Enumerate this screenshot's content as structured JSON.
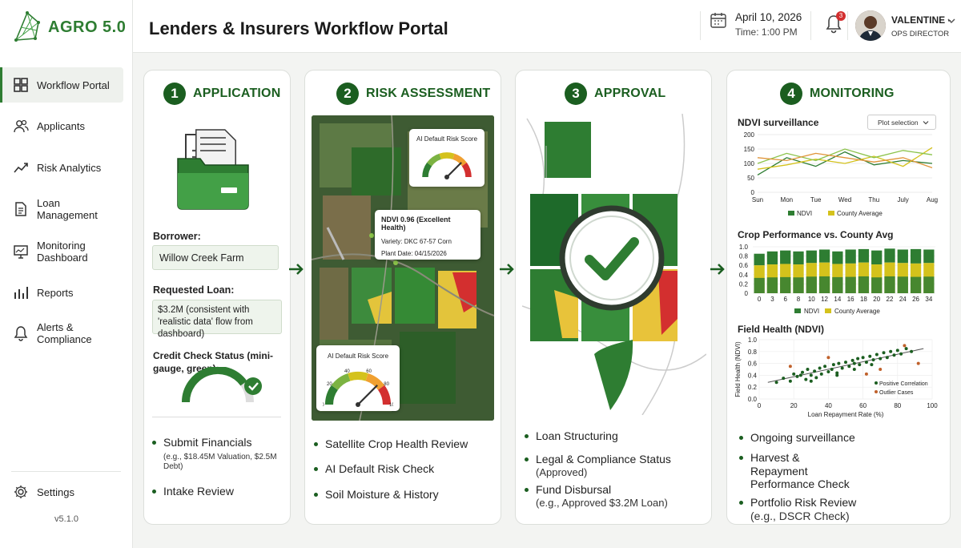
{
  "brand": {
    "name": "AGRO 5.0"
  },
  "header": {
    "title": "Lenders & Insurers Workflow Portal",
    "date": "April 10, 2026",
    "time": "Time: 1:00 PM",
    "notif_count": "3",
    "user_name": "VALENTINE -",
    "user_role": "OPS DIRECTOR"
  },
  "sidebar": {
    "items": [
      {
        "label": "Workflow Portal",
        "icon": "grid-icon",
        "active": true
      },
      {
        "label": "Applicants",
        "icon": "users-icon"
      },
      {
        "label": "Risk Analytics",
        "icon": "trend-icon"
      },
      {
        "label": "Loan Management",
        "icon": "document-icon"
      },
      {
        "label": "Monitoring Dashboard",
        "icon": "monitor-icon"
      },
      {
        "label": "Reports",
        "icon": "bar-chart-icon"
      },
      {
        "label": "Alerts & Compliance",
        "icon": "bell-icon"
      }
    ],
    "settings": "Settings",
    "version": "v5.1.0"
  },
  "steps": [
    {
      "num": "1",
      "title": "APPLICATION"
    },
    {
      "num": "2",
      "title": "RISK ASSESSMENT"
    },
    {
      "num": "3",
      "title": "APPROVAL"
    },
    {
      "num": "4",
      "title": "MONITORING"
    }
  ],
  "application": {
    "borrower_label": "Borrower:",
    "borrower_value": "Willow Creek Farm",
    "loan_label": "Requested Loan:",
    "loan_value": "$3.2M (consistent with 'realistic data' flow from dashboard)",
    "credit_label": "Credit Check Status (mini-gauge, green):",
    "credit_level": 0.8,
    "bullets": [
      {
        "text": "Submit Financials",
        "sub": "(e.g., $18.45M Valuation, $2.5M Debt)"
      },
      {
        "text": "Intake Review",
        "sub": ""
      }
    ]
  },
  "risk": {
    "gauge_top_title": "AI Default Risk Score",
    "gauge_bottom_title": "AI Default Risk Score",
    "gauge_ticks": [
      "0",
      "20",
      "40",
      "60",
      "80",
      "100"
    ],
    "gauge_value": 75,
    "ndvi_title": "NDVI 0.96 (Excellent Health)",
    "variety": "Variety: DKC 67-57 Corn",
    "plant_date": "Plant Date: 04/15/2026",
    "bullets": [
      {
        "text": "Satellite Crop Health Review"
      },
      {
        "text": "AI Default Risk Check"
      },
      {
        "text": "Soil Moisture & History"
      }
    ]
  },
  "approval": {
    "bullets": [
      {
        "text": "Loan Structuring",
        "sub": ""
      },
      {
        "text": "Legal & Compliance Status",
        "sub": "(Approved)"
      },
      {
        "text": "Fund Disbursal",
        "sub": "(e.g., Approved $3.2M Loan)"
      }
    ]
  },
  "monitoring": {
    "ndvi_title": "NDVI surveillance",
    "plot_select": "Plot selection",
    "perf_title": "Crop Performance vs. County Avg",
    "health_title": "Field Health (NDVI)",
    "bullets": [
      {
        "text": "Ongoing surveillance",
        "sub": ""
      },
      {
        "text": "Harvest & Repayment Performance Check",
        "sub": ""
      },
      {
        "text": "Portfolio Risk Review",
        "sub": "(e.g., DSCR Check)"
      }
    ]
  },
  "chart_data": [
    {
      "type": "line",
      "title": "NDVI surveillance",
      "categories": [
        "Sun",
        "Mon",
        "Tue",
        "Wed",
        "Thu",
        "July",
        "Aug"
      ],
      "yticks": [
        "0",
        "50",
        "100",
        "150",
        "200"
      ],
      "ylim": [
        0,
        200
      ],
      "legend": [
        "NDVI",
        "County Average"
      ],
      "series": [
        {
          "name": "NDVI",
          "color": "#2e7d32",
          "values": [
            60,
            120,
            90,
            140,
            95,
            110,
            100
          ]
        },
        {
          "name": "County Average",
          "color": "#d4c21c",
          "values": [
            80,
            95,
            115,
            100,
            125,
            90,
            155
          ]
        },
        {
          "color": "#8bc34a",
          "values": [
            100,
            135,
            110,
            150,
            120,
            145,
            130
          ]
        },
        {
          "color": "#e0953a",
          "values": [
            120,
            110,
            135,
            120,
            105,
            120,
            85
          ]
        }
      ]
    },
    {
      "type": "bar",
      "title": "Crop Performance vs. County Avg",
      "categories": [
        "0",
        "3",
        "6",
        "8",
        "10",
        "12",
        "14",
        "16",
        "18",
        "20",
        "22",
        "24",
        "26",
        "34"
      ],
      "yticks": [
        "0",
        "0.2",
        "0.4",
        "0.6",
        "0.8",
        "1.0"
      ],
      "ylim": [
        0,
        1
      ],
      "legend": [
        "NDVI",
        "County Average"
      ],
      "series": [
        {
          "name": "NDVI",
          "color": "#2e7d32",
          "values": [
            0.85,
            0.9,
            0.92,
            0.9,
            0.92,
            0.94,
            0.9,
            0.94,
            0.95,
            0.92,
            0.96,
            0.94,
            0.95,
            0.94
          ]
        },
        {
          "name": "County Average",
          "color": "#d4c21c",
          "values": [
            0.6,
            0.62,
            0.63,
            0.62,
            0.65,
            0.66,
            0.63,
            0.64,
            0.66,
            0.62,
            0.66,
            0.65,
            0.64,
            0.65
          ]
        }
      ]
    },
    {
      "type": "scatter",
      "title": "Field Health (NDVI)",
      "xlabel": "Loan Repayment Rate (%)",
      "ylabel": "Field Health (NDVI)",
      "xticks": [
        "0",
        "20",
        "40",
        "60",
        "80",
        "100"
      ],
      "yticks": [
        "0.0",
        "0.2",
        "0.4",
        "0.6",
        "0.8",
        "1.0"
      ],
      "xlim": [
        0,
        100
      ],
      "ylim": [
        0,
        1
      ],
      "legend": [
        "Positive Correlation",
        "Outlier Cases"
      ],
      "series": [
        {
          "name": "Positive Correlation",
          "color": "#1b5e20",
          "points": [
            [
              10,
              0.28
            ],
            [
              14,
              0.35
            ],
            [
              18,
              0.3
            ],
            [
              20,
              0.42
            ],
            [
              22,
              0.38
            ],
            [
              25,
              0.45
            ],
            [
              27,
              0.33
            ],
            [
              28,
              0.5
            ],
            [
              30,
              0.4
            ],
            [
              32,
              0.47
            ],
            [
              33,
              0.36
            ],
            [
              35,
              0.52
            ],
            [
              36,
              0.42
            ],
            [
              38,
              0.55
            ],
            [
              40,
              0.46
            ],
            [
              42,
              0.5
            ],
            [
              43,
              0.58
            ],
            [
              45,
              0.44
            ],
            [
              46,
              0.6
            ],
            [
              48,
              0.52
            ],
            [
              50,
              0.62
            ],
            [
              52,
              0.55
            ],
            [
              54,
              0.65
            ],
            [
              55,
              0.5
            ],
            [
              57,
              0.68
            ],
            [
              58,
              0.58
            ],
            [
              60,
              0.7
            ],
            [
              62,
              0.62
            ],
            [
              64,
              0.72
            ],
            [
              66,
              0.66
            ],
            [
              68,
              0.75
            ],
            [
              70,
              0.68
            ],
            [
              72,
              0.78
            ],
            [
              74,
              0.7
            ],
            [
              76,
              0.8
            ],
            [
              78,
              0.74
            ],
            [
              80,
              0.82
            ],
            [
              82,
              0.76
            ],
            [
              85,
              0.85
            ],
            [
              88,
              0.8
            ],
            [
              30,
              0.3
            ],
            [
              45,
              0.4
            ],
            [
              55,
              0.6
            ],
            [
              65,
              0.58
            ],
            [
              24,
              0.4
            ]
          ]
        },
        {
          "name": "Outlier Cases",
          "color": "#c0612b",
          "points": [
            [
              18,
              0.55
            ],
            [
              62,
              0.42
            ],
            [
              84,
              0.9
            ],
            [
              92,
              0.6
            ],
            [
              40,
              0.7
            ],
            [
              70,
              0.5
            ]
          ]
        }
      ]
    }
  ]
}
